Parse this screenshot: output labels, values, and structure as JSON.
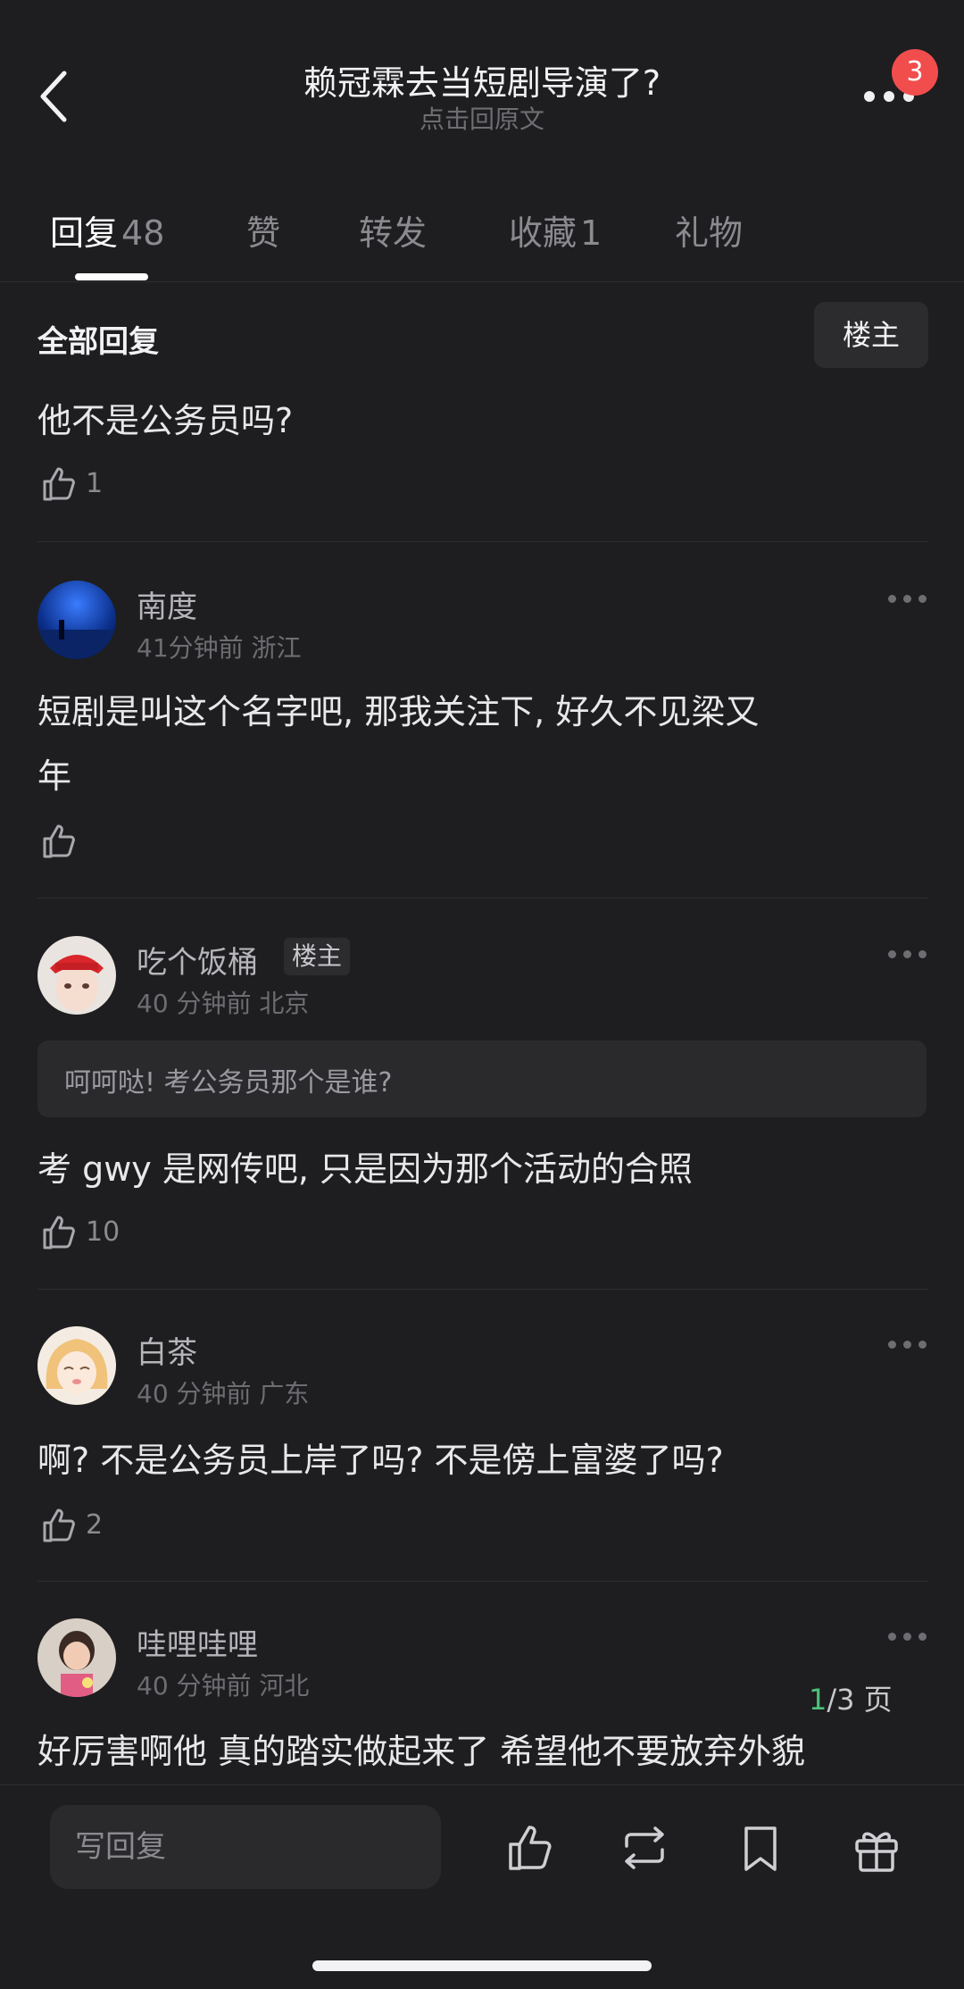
{
  "header": {
    "title": "赖冠霖去当短剧导演了?",
    "subtitle": "点击回原文",
    "notification_count": "3"
  },
  "tabs": [
    {
      "label": "回复",
      "count": "48"
    },
    {
      "label": "赞",
      "count": ""
    },
    {
      "label": "转发",
      "count": ""
    },
    {
      "label": "收藏",
      "count": "1"
    },
    {
      "label": "礼物",
      "count": ""
    }
  ],
  "filter": {
    "label": "全部回复",
    "owner_button": "楼主"
  },
  "first_reply": {
    "text": "他不是公务员吗?",
    "likes": "1"
  },
  "comments": [
    {
      "username": "南度",
      "meta": "41分钟前 浙江",
      "text_line1": "短剧是叫这个名字吧, 那我关注下, 好久不见梁又",
      "text_line2": "年",
      "likes": ""
    },
    {
      "username": "吃个饭桶",
      "owner_tag": "楼主",
      "meta": "40 分钟前 北京",
      "quote": "呵呵哒! 考公务员那个是谁?",
      "text": "考 gwy 是网传吧, 只是因为那个活动的合照",
      "likes": "10"
    },
    {
      "username": "白茶",
      "meta": "40 分钟前 广东",
      "text": "啊? 不是公务员上岸了吗? 不是傍上富婆了吗?",
      "likes": "2"
    },
    {
      "username": "哇哩哇哩",
      "meta": "40 分钟前 河北",
      "text": "好厉害啊他 真的踏实做起来了 希望他不要放弃外貌"
    }
  ],
  "pagination": {
    "current": "1",
    "rest": "/3 页"
  },
  "bottom_bar": {
    "reply_placeholder": "写回复"
  },
  "colors": {
    "background": "#1e1e20",
    "badge": "#f24d4d",
    "page_current": "#4cc27a"
  }
}
